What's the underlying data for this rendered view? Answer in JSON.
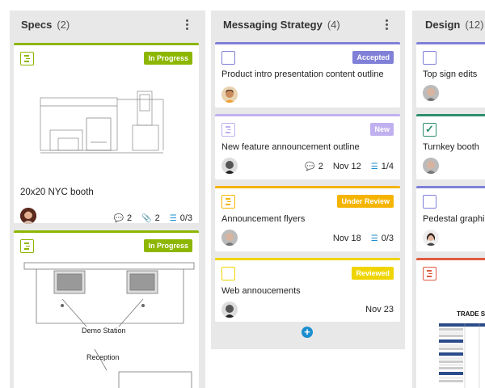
{
  "columns": [
    {
      "title": "Specs",
      "count": "(2)",
      "cards": [
        {
          "status": "In Progress",
          "status_color": "#8db600",
          "title": "20x20 NYC booth",
          "comments": "2",
          "attachments": "2",
          "checklist": "0/3"
        },
        {
          "status": "In Progress",
          "status_color": "#8db600",
          "drawing_label_1": "Demo Station",
          "drawing_label_2": "Reception"
        }
      ]
    },
    {
      "title": "Messaging Strategy",
      "count": "(4)",
      "cards": [
        {
          "status": "Accepted",
          "status_color": "#8080d8",
          "title": "Product intro presentation content outline"
        },
        {
          "status": "New",
          "status_color": "#c0b0ef",
          "title": "New feature announcement outline",
          "comments": "2",
          "due": "Nov 12",
          "checklist": "1/4"
        },
        {
          "status": "Under Review",
          "status_color": "#f5b400",
          "title": "Announcement flyers",
          "due": "Nov 18",
          "checklist": "0/3"
        },
        {
          "status": "Reviewed",
          "status_color": "#efd400",
          "title": "Web annoucements",
          "due": "Nov 23"
        }
      ]
    },
    {
      "title": "Design",
      "count": "(12)",
      "cards": [
        {
          "title": "Top sign edits"
        },
        {
          "title": "Turnkey booth"
        },
        {
          "title": "Pedestal graphic"
        },
        {
          "sheet_title": "TRADE S"
        }
      ]
    }
  ]
}
